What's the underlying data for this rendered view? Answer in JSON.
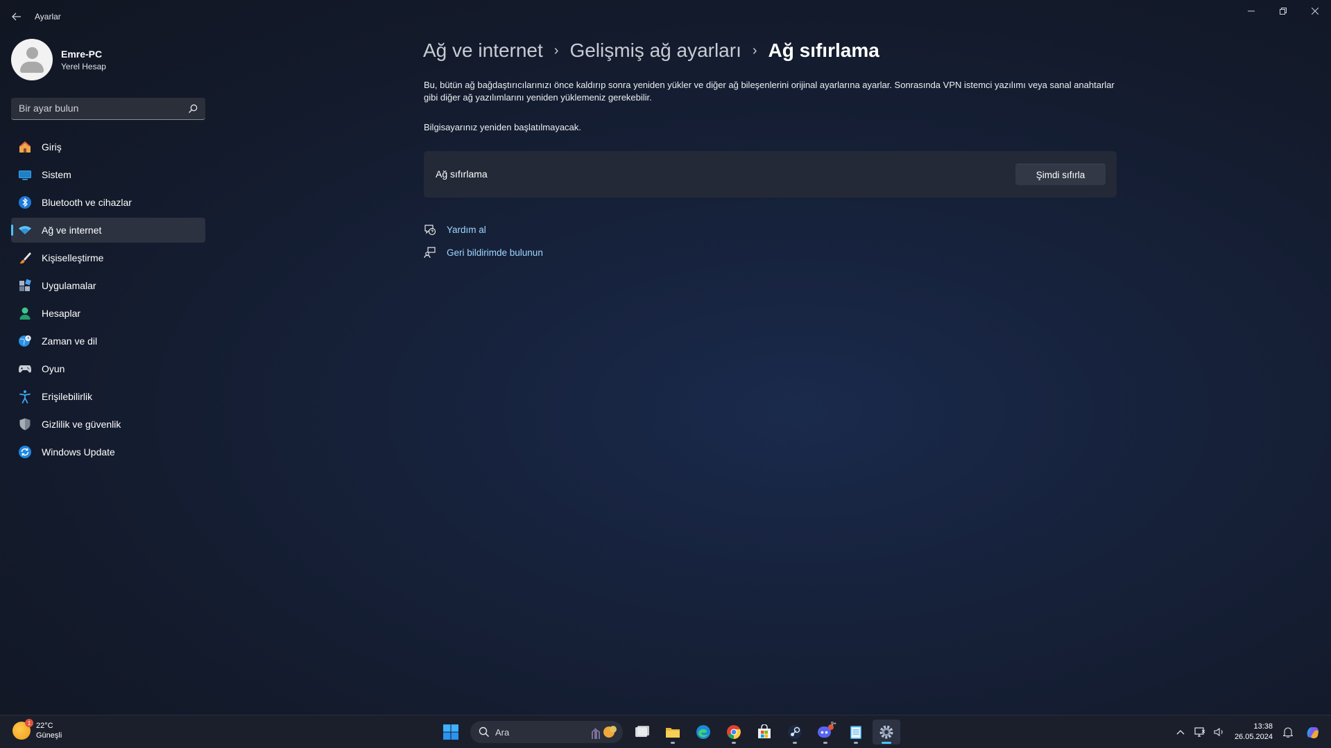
{
  "window": {
    "title": "Ayarlar"
  },
  "profile": {
    "name": "Emre-PC",
    "account_type": "Yerel Hesap"
  },
  "search": {
    "placeholder": "Bir ayar bulun"
  },
  "nav": {
    "items": [
      {
        "label": "Giriş",
        "icon": "home-icon"
      },
      {
        "label": "Sistem",
        "icon": "monitor-icon"
      },
      {
        "label": "Bluetooth ve cihazlar",
        "icon": "bluetooth-icon"
      },
      {
        "label": "Ağ ve internet",
        "icon": "wifi-icon",
        "active": true
      },
      {
        "label": "Kişiselleştirme",
        "icon": "brush-icon"
      },
      {
        "label": "Uygulamalar",
        "icon": "apps-icon"
      },
      {
        "label": "Hesaplar",
        "icon": "person-icon"
      },
      {
        "label": "Zaman ve dil",
        "icon": "globe-clock-icon"
      },
      {
        "label": "Oyun",
        "icon": "gamepad-icon"
      },
      {
        "label": "Erişilebilirlik",
        "icon": "accessibility-icon"
      },
      {
        "label": "Gizlilik ve güvenlik",
        "icon": "shield-icon"
      },
      {
        "label": "Windows Update",
        "icon": "update-icon"
      }
    ]
  },
  "breadcrumb": {
    "items": [
      "Ağ ve internet",
      "Gelişmiş ağ ayarları",
      "Ağ sıfırlama"
    ]
  },
  "content": {
    "description": "Bu, bütün ağ bağdaştırıcılarınızı önce kaldırıp sonra yeniden yükler ve diğer ağ bileşenlerini orijinal ayarlarına ayarlar. Sonrasında VPN istemci yazılımı veya sanal anahtarlar gibi diğer ağ yazılımlarını yeniden yüklemeniz gerekebilir.",
    "note": "Bilgisayarınız yeniden başlatılmayacak.",
    "card_label": "Ağ sıfırlama",
    "reset_button": "Şimdi sıfırla",
    "links": [
      {
        "label": "Yardım al",
        "icon": "help-icon"
      },
      {
        "label": "Geri bildirimde bulunun",
        "icon": "feedback-icon"
      }
    ]
  },
  "taskbar": {
    "weather": {
      "temp": "22°C",
      "condition": "Güneşli",
      "badge": "1"
    },
    "search_label": "Ara",
    "discord_badge": "9+",
    "time": "13:38",
    "date": "26.05.2024"
  },
  "colors": {
    "accent": "#4cc2ff",
    "link": "#9fd8ff",
    "card": "#232936"
  }
}
